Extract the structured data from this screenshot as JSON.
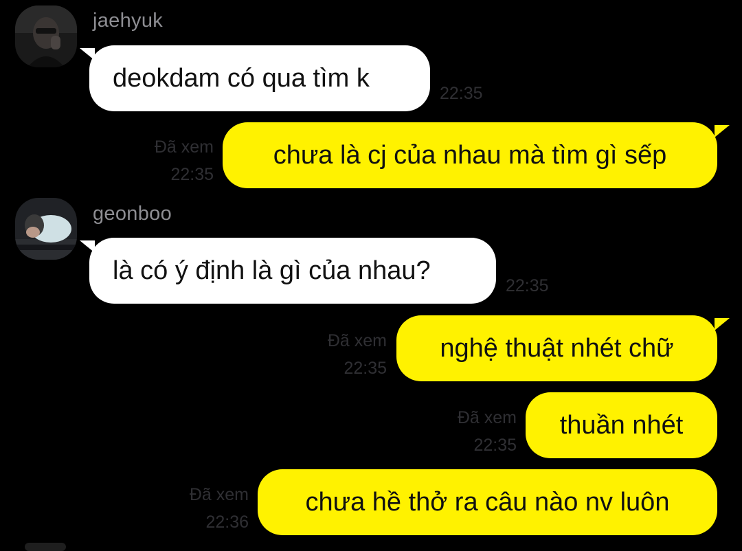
{
  "messages": [
    {
      "type": "incoming",
      "sender": "jaehyuk",
      "text": "deokdam có qua tìm k",
      "time": "22:35",
      "avatar": "jaehyuk-avatar"
    },
    {
      "type": "outgoing",
      "status": "Đã xem",
      "time": "22:35",
      "text": "chưa là cj của nhau mà tìm gì sếp"
    },
    {
      "type": "incoming",
      "sender": "geonboo",
      "text": "là có ý định là gì của nhau?",
      "time": "22:35",
      "avatar": "geonboo-avatar"
    },
    {
      "type": "outgoing",
      "status": "Đã xem",
      "time": "22:35",
      "text": "nghệ thuật nhét chữ"
    },
    {
      "type": "outgoing",
      "status": "Đã xem",
      "time": "22:35",
      "text": "thuần nhét"
    },
    {
      "type": "outgoing",
      "status": "Đã xem",
      "time": "22:36",
      "text": "chưa hề thở ra câu nào nv luôn"
    }
  ],
  "colors": {
    "background": "#000000",
    "incoming_bubble": "#ffffff",
    "outgoing_bubble": "#fff200",
    "meta_text": "#2f2f33",
    "sender_text": "#8e8e93"
  }
}
